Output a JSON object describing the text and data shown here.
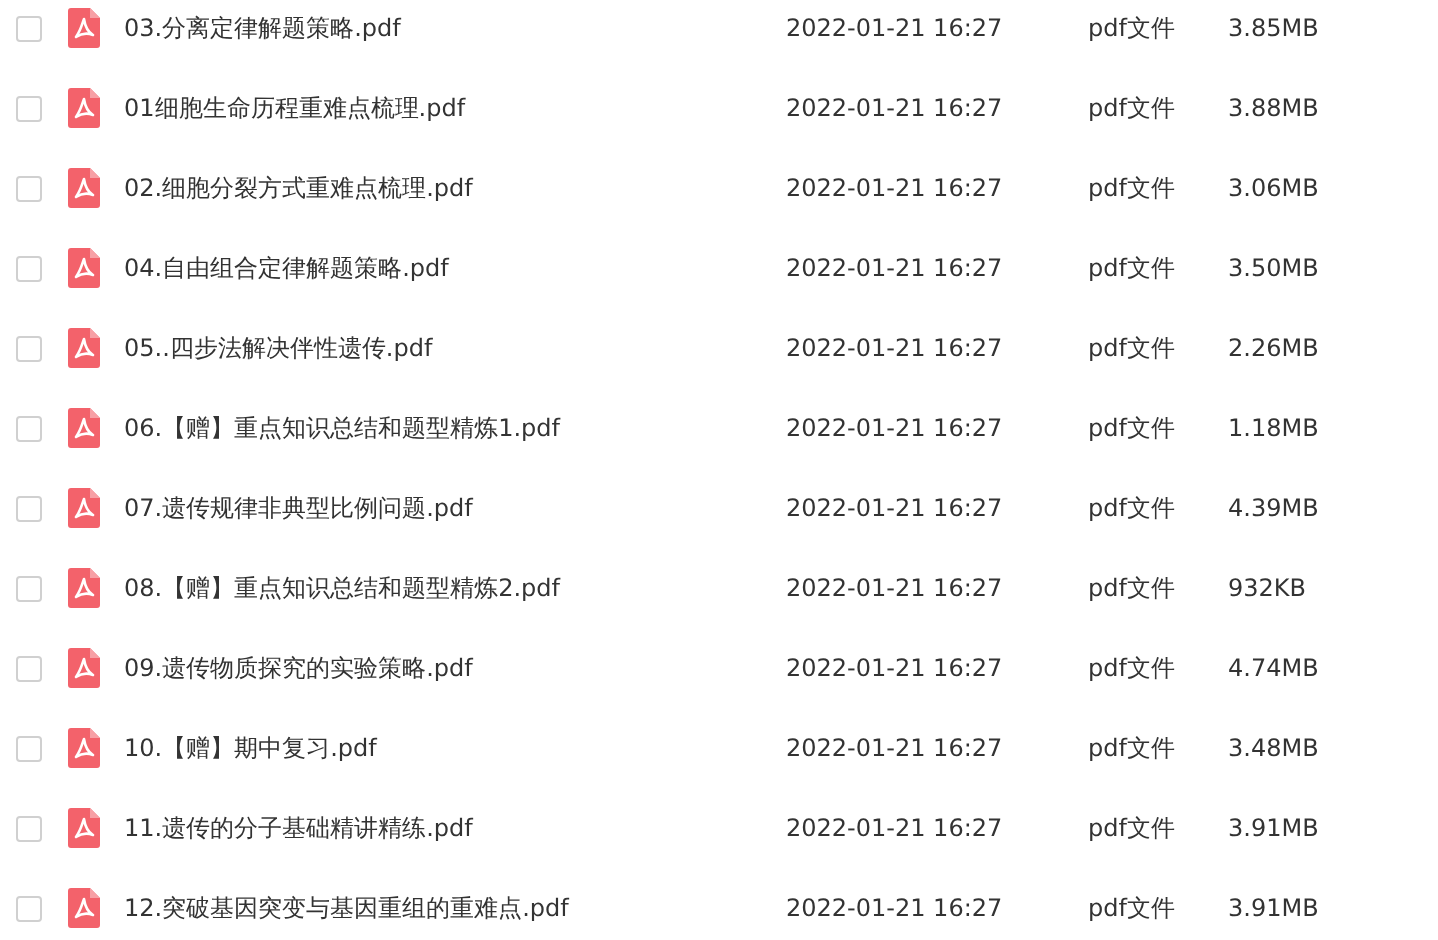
{
  "files": [
    {
      "name": "03.分离定律解题策略.pdf",
      "date": "2022-01-21 16:27",
      "type": "pdf文件",
      "size": "3.85MB",
      "checked": false
    },
    {
      "name": "01细胞生命历程重难点梳理.pdf",
      "date": "2022-01-21 16:27",
      "type": "pdf文件",
      "size": "3.88MB",
      "checked": false
    },
    {
      "name": "02.细胞分裂方式重难点梳理.pdf",
      "date": "2022-01-21 16:27",
      "type": "pdf文件",
      "size": "3.06MB",
      "checked": false
    },
    {
      "name": "04.自由组合定律解题策略.pdf",
      "date": "2022-01-21 16:27",
      "type": "pdf文件",
      "size": "3.50MB",
      "checked": false
    },
    {
      "name": "05..四步法解决伴性遗传.pdf",
      "date": "2022-01-21 16:27",
      "type": "pdf文件",
      "size": "2.26MB",
      "checked": false
    },
    {
      "name": "06.【赠】重点知识总结和题型精炼1.pdf",
      "date": "2022-01-21 16:27",
      "type": "pdf文件",
      "size": "1.18MB",
      "checked": false
    },
    {
      "name": "07.遗传规律非典型比例问题.pdf",
      "date": "2022-01-21 16:27",
      "type": "pdf文件",
      "size": "4.39MB",
      "checked": false
    },
    {
      "name": "08.【赠】重点知识总结和题型精炼2.pdf",
      "date": "2022-01-21 16:27",
      "type": "pdf文件",
      "size": "932KB",
      "checked": false
    },
    {
      "name": "09.遗传物质探究的实验策略.pdf",
      "date": "2022-01-21 16:27",
      "type": "pdf文件",
      "size": "4.74MB",
      "checked": false
    },
    {
      "name": "10.【赠】期中复习.pdf",
      "date": "2022-01-21 16:27",
      "type": "pdf文件",
      "size": "3.48MB",
      "checked": false
    },
    {
      "name": "11.遗传的分子基础精讲精练.pdf",
      "date": "2022-01-21 16:27",
      "type": "pdf文件",
      "size": "3.91MB",
      "checked": false
    },
    {
      "name": "12.突破基因突变与基因重组的重难点.pdf",
      "date": "2022-01-21 16:27",
      "type": "pdf文件",
      "size": "3.91MB",
      "checked": false
    }
  ]
}
